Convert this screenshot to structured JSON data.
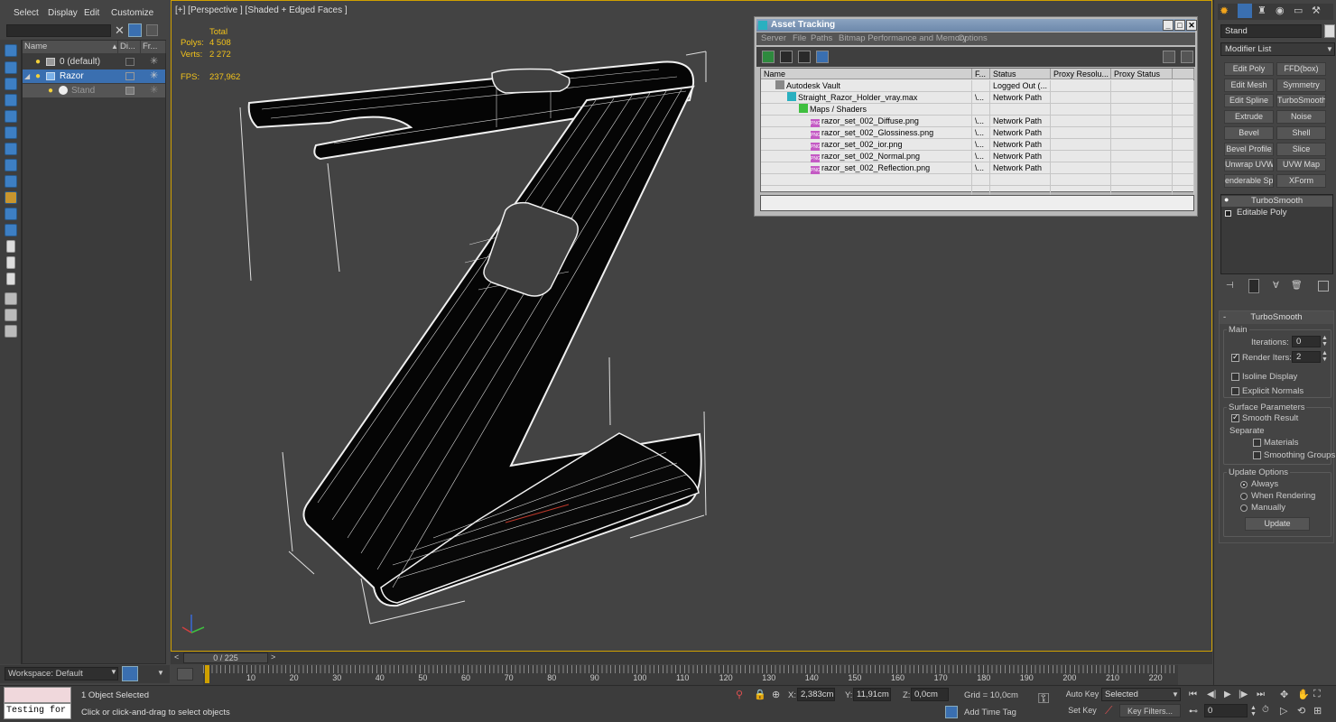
{
  "menu": {
    "select": "Select",
    "display": "Display",
    "edit": "Edit",
    "customize": "Customize"
  },
  "explorer": {
    "columns": [
      "Name",
      "Di...",
      "Fr..."
    ],
    "rows": [
      {
        "label": "0 (default)"
      },
      {
        "label": "Razor"
      },
      {
        "label": "Stand"
      }
    ]
  },
  "workspace": {
    "label": "Workspace: Default"
  },
  "viewport": {
    "label": "[+] [Perspective ] [Shaded + Edged Faces ]",
    "stats": {
      "total": "Total",
      "polys_label": "Polys:",
      "polys_value": "4 508",
      "verts_label": "Verts:",
      "verts_value": "2 272",
      "fps_label": "FPS:",
      "fps_value": "237,962"
    }
  },
  "asset_tracking": {
    "title": "Asset Tracking",
    "menu": [
      "Server",
      "File",
      "Paths",
      "Bitmap Performance and Memory",
      "Options"
    ],
    "columns": [
      "Name",
      "F...",
      "Status",
      "Proxy Resolu...",
      "Proxy Status"
    ],
    "rows": [
      {
        "name": "Autodesk Vault",
        "path": "",
        "status": "Logged Out (...",
        "indent": 1
      },
      {
        "name": "Straight_Razor_Holder_vray.max",
        "path": "\\...",
        "status": "Network Path",
        "indent": 2
      },
      {
        "name": "Maps / Shaders",
        "path": "",
        "status": "",
        "indent": 3
      },
      {
        "name": "razor_set_002_Diffuse.png",
        "path": "\\...",
        "status": "Network Path",
        "indent": 4
      },
      {
        "name": "razor_set_002_Glossiness.png",
        "path": "\\...",
        "status": "Network Path",
        "indent": 4
      },
      {
        "name": "razor_set_002_ior.png",
        "path": "\\...",
        "status": "Network Path",
        "indent": 4
      },
      {
        "name": "razor_set_002_Normal.png",
        "path": "\\...",
        "status": "Network Path",
        "indent": 4
      },
      {
        "name": "razor_set_002_Reflection.png",
        "path": "\\...",
        "status": "Network Path",
        "indent": 4
      }
    ],
    "png_tag": "PNG"
  },
  "command_panel": {
    "object_name": "Stand",
    "modifier_list": "Modifier List",
    "buttons": [
      "Edit Poly",
      "FFD(box)",
      "Edit Mesh",
      "Symmetry",
      "Edit Spline",
      "TurboSmooth",
      "Extrude",
      "Noise",
      "Bevel",
      "Shell",
      "Bevel Profile",
      "Slice",
      "Unwrap UVW",
      "UVW Map",
      "enderable Splin",
      "XForm"
    ],
    "stack": [
      "TurboSmooth",
      "Editable Poly"
    ],
    "rollout_title": "TurboSmooth",
    "main": "Main",
    "iterations_label": "Iterations:",
    "iterations_value": "0",
    "render_iters_label": "Render Iters:",
    "render_iters_value": "2",
    "isoline_label": "Isoline Display",
    "explicit_label": "Explicit Normals",
    "surface_label": "Surface Parameters",
    "smooth_label": "Smooth Result",
    "separate_label": "Separate",
    "materials_label": "Materials",
    "smoothing_label": "Smoothing Groups",
    "update_options_label": "Update Options",
    "always_label": "Always",
    "when_rendering_label": "When Rendering",
    "manually_label": "Manually",
    "update_button": "Update"
  },
  "timeline": {
    "frame_label": "0 / 225",
    "ticks": [
      "10",
      "20",
      "30",
      "40",
      "50",
      "60",
      "70",
      "80",
      "90",
      "100",
      "110",
      "120",
      "130",
      "140",
      "150",
      "160",
      "170",
      "180",
      "190",
      "200",
      "210",
      "220"
    ]
  },
  "status": {
    "script_text": "Testing for ;",
    "selected": "1 Object Selected",
    "hint": "Click or click-and-drag to select objects",
    "x_label": "X:",
    "x_value": "2,383cm",
    "y_label": "Y:",
    "y_value": "11,91cm",
    "z_label": "Z:",
    "z_value": "0,0cm",
    "grid": "Grid = 10,0cm",
    "add_time_tag": "Add Time Tag",
    "auto_key": "Auto Key",
    "set_key": "Set Key",
    "selected_dropdown": "Selected",
    "key_filters": "Key Filters...",
    "frame_value": "0"
  },
  "colors": {
    "accent": "#cfa000",
    "selection": "#3a6fb0",
    "stats": "#f2c21b"
  }
}
